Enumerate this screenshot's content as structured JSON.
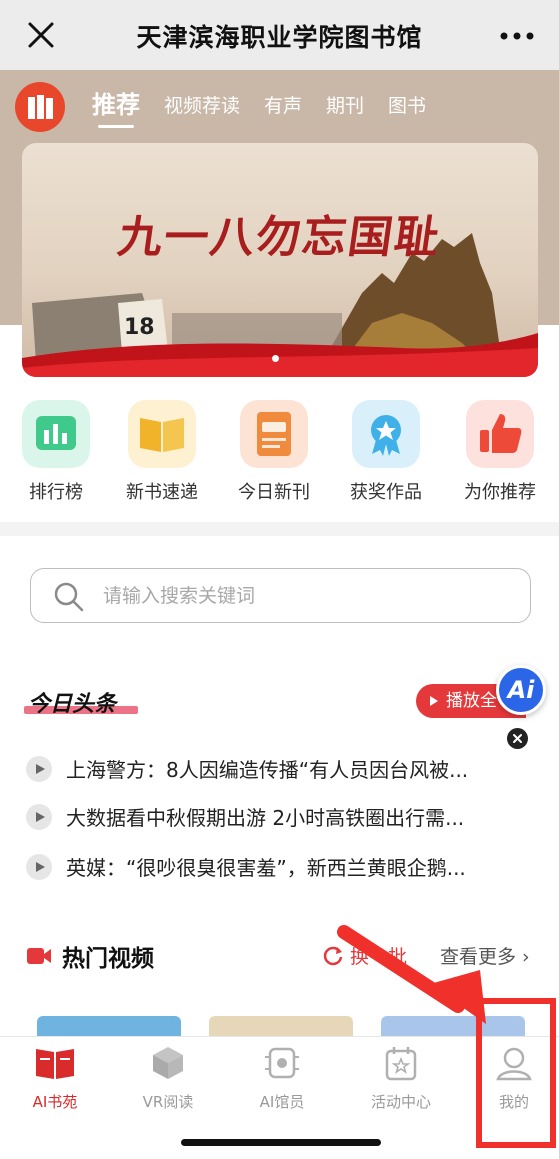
{
  "titlebar": {
    "title": "天津滨海职业学院图书馆",
    "close_icon": "close-icon",
    "more_icon": "more-icon"
  },
  "top_tabs": [
    {
      "label": "推荐",
      "active": true
    },
    {
      "label": "视频荐读",
      "active": false
    },
    {
      "label": "有声",
      "active": false
    },
    {
      "label": "期刊",
      "active": false
    },
    {
      "label": "图书",
      "active": false
    }
  ],
  "banner": {
    "title": "九一八勿忘国耻",
    "badge": "18"
  },
  "quick_entries": [
    {
      "label": "排行榜",
      "icon": "ranking-icon",
      "color": "#3fc98a"
    },
    {
      "label": "新书速递",
      "icon": "open-book-icon",
      "color": "#f0b32a"
    },
    {
      "label": "今日新刊",
      "icon": "new-journal-icon",
      "color": "#f08a3c"
    },
    {
      "label": "获奖作品",
      "icon": "award-icon",
      "color": "#3fb1e8"
    },
    {
      "label": "为你推荐",
      "icon": "thumbs-up-icon",
      "color": "#ee4a3a"
    }
  ],
  "search": {
    "placeholder": "请输入搜索关键词",
    "value": ""
  },
  "headlines": {
    "title": "今日头条",
    "play_all": "播放全",
    "ai_label": "Ai",
    "items": [
      "上海警方：8人因编造传播“有人员因台风被...",
      "大数据看中秋假期出游 2小时高铁圈出行需...",
      "英媒：“很吵很臭很害羞”，新西兰黄眼企鹅..."
    ]
  },
  "hot_videos": {
    "title": "热门视频",
    "refresh": "换一批",
    "see_more": "查看更多"
  },
  "tabbar": [
    {
      "label": "AI书苑",
      "icon": "book-icon",
      "active": true
    },
    {
      "label": "VR阅读",
      "icon": "cube-icon",
      "active": false
    },
    {
      "label": "AI馆员",
      "icon": "chip-icon",
      "active": false
    },
    {
      "label": "活动中心",
      "icon": "calendar-star-icon",
      "active": false
    },
    {
      "label": "我的",
      "icon": "user-icon",
      "active": false
    }
  ],
  "colors": {
    "accent": "#e5383b",
    "annotation": "#f0302a",
    "hero_bg": "#c9b7a8"
  }
}
